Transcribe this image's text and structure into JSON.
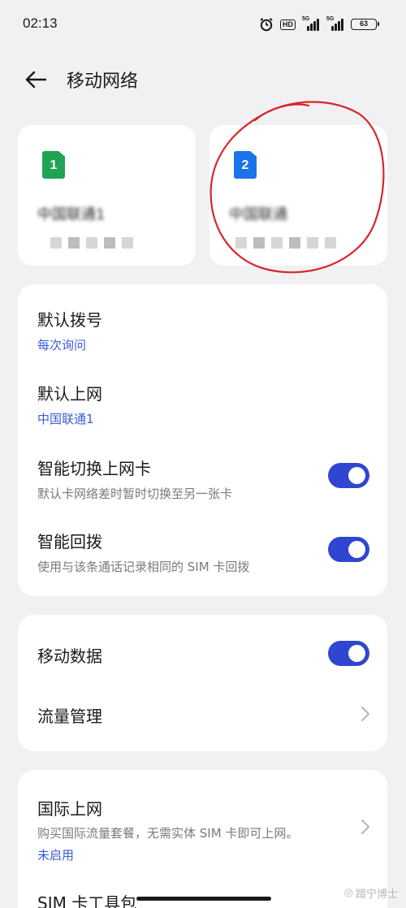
{
  "status_bar": {
    "time": "02:13",
    "hd_label": "HD",
    "signal1_label": "5G",
    "signal2_label": "5G",
    "battery": "63"
  },
  "header": {
    "title": "移动网络"
  },
  "sim_cards": [
    {
      "slot": "1",
      "name": "中国联通1",
      "color": "#1fa453"
    },
    {
      "slot": "2",
      "name": "中国联通",
      "color": "#1a73e8"
    }
  ],
  "sim_settings": {
    "default_call": {
      "title": "默认拨号",
      "value": "每次询问"
    },
    "default_data": {
      "title": "默认上网",
      "value": "中国联通1"
    },
    "smart_switch": {
      "title": "智能切换上网卡",
      "subtitle": "默认卡网络差时暂时切换至另一张卡",
      "enabled": true
    },
    "smart_redial": {
      "title": "智能回拨",
      "subtitle": "使用与该条通话记录相同的 SIM 卡回拨",
      "enabled": true
    }
  },
  "data_settings": {
    "mobile_data": {
      "title": "移动数据",
      "enabled": true
    },
    "traffic": {
      "title": "流量管理"
    }
  },
  "intl_settings": {
    "roaming": {
      "title": "国际上网",
      "subtitle": "购买国际流量套餐，无需实体 SIM 卡即可上网。",
      "status": "未启用"
    },
    "sim_toolkit": {
      "title": "SIM 卡工具包"
    }
  },
  "watermark": "蹭宁博士",
  "colors": {
    "accent": "#2f46d1",
    "link_blue": "#3a5bd9",
    "annotation_red": "#d8262a"
  }
}
